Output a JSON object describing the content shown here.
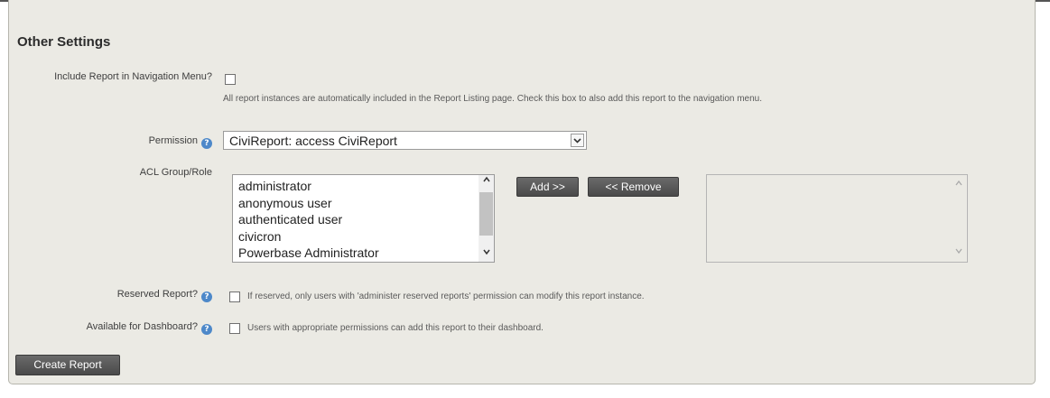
{
  "section_title": "Other Settings",
  "nav_menu": {
    "label": "Include Report in Navigation Menu?",
    "description": "All report instances are automatically included in the Report Listing page. Check this box to also add this report to the navigation menu.",
    "checked": false
  },
  "permission": {
    "label": "Permission",
    "selected": "CiviReport: access CiviReport"
  },
  "acl": {
    "label": "ACL Group/Role",
    "options": [
      "administrator",
      "anonymous user",
      "authenticated user",
      "civicron",
      "Powerbase Administrator"
    ],
    "add_label": "Add >>",
    "remove_label": "<< Remove"
  },
  "reserved": {
    "label": "Reserved Report?",
    "description": "If reserved, only users with 'administer reserved reports' permission can modify this report instance.",
    "checked": false
  },
  "dashboard": {
    "label": "Available for Dashboard?",
    "description": "Users with appropriate permissions can add this report to their dashboard.",
    "checked": false
  },
  "create_label": "Create Report",
  "icons": {
    "help": "?",
    "chevron_down": "⌄",
    "scroll_up": "^",
    "scroll_down": "v"
  }
}
